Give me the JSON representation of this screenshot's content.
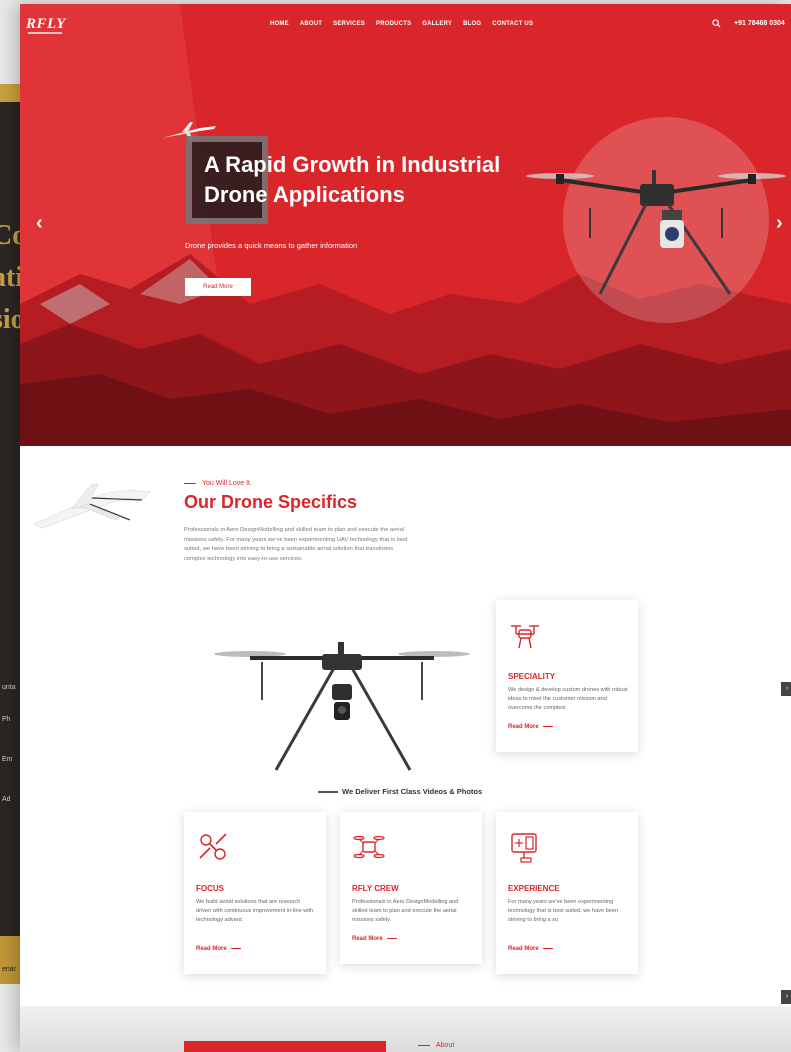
{
  "site": {
    "logo": "RFLY",
    "nav": [
      "HOME",
      "ABOUT",
      "SERVICES",
      "PRODUCTS",
      "GALLERY",
      "BLOG",
      "CONTACT US"
    ],
    "phone": "+91 78468 0304"
  },
  "hero": {
    "title_line1": "A Rapid Growth in Industrial",
    "title_line2": "Drone Applications",
    "subtitle": "Drone provides a quick means to gather information",
    "button": "Read More"
  },
  "specifics": {
    "label": "You Will Love It.",
    "title_part1": "Our Drone",
    "title_part2": "Specifics",
    "text": "Professionals in Aero DesignModelling and skilled team to plan and execute the aerial missions safely. For many years we've been experimenting UAV technology that is best suited, we have been striving to bring a sustainable aerial solution that transforms complex technology into easy-to-use services."
  },
  "cards": {
    "speciality": {
      "title": "SPECIALITY",
      "text": "We design & develop custom drones with robust ideas to meet the customer mission and overcome the complexi",
      "more": "Read More"
    },
    "focus": {
      "title": "FOCUS",
      "text": "We build aerial solutions that are research driven with continuous improvement in-line with technology advanc",
      "more": "Read More"
    },
    "crew": {
      "title": "RFLY CREW",
      "text": "Professionals in Aero DesignModelling and skilled team to plan and execute the aerial missions safely.",
      "more": "Read More"
    },
    "experience": {
      "title": "EXPERIENCE",
      "text": "For many years we've been experimenting technology that is best suited, we have been striving to bring a su",
      "more": "Read More"
    }
  },
  "deliver": "We Deliver First Class Videos & Photos",
  "about_label": "About",
  "back_page": {
    "text1": "Co",
    "text2": "ati",
    "text3": "sio",
    "side1": "unta",
    "side2": "Ph",
    "side3": "Em",
    "side4": "Ad",
    "side5": "enar"
  },
  "colors": {
    "brand": "#d9262a",
    "dark": "#2b2623",
    "gold": "#c8a043"
  }
}
